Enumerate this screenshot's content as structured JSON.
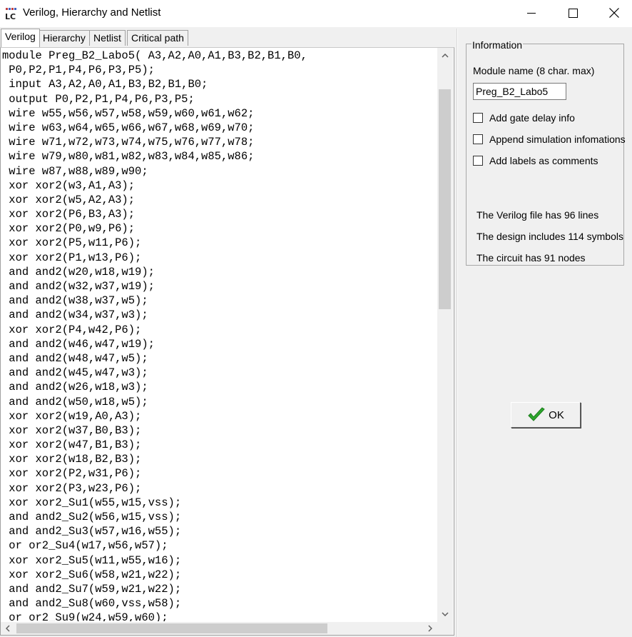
{
  "window": {
    "title": "Verilog, Hierarchy and Netlist",
    "app_icon": "verilog-app-icon",
    "controls": [
      "minimize-icon",
      "maximize-icon",
      "close-icon"
    ]
  },
  "tabs": [
    {
      "label": "Verilog",
      "active": true
    },
    {
      "label": "Hierarchy",
      "active": false
    },
    {
      "label": "Netlist",
      "active": false
    },
    {
      "label": "Critical path",
      "active": false
    }
  ],
  "code_lines": [
    "module Preg_B2_Labo5( A3,A2,A0,A1,B3,B2,B1,B0,",
    " P0,P2,P1,P4,P6,P3,P5);",
    " input A3,A2,A0,A1,B3,B2,B1,B0;",
    " output P0,P2,P1,P4,P6,P3,P5;",
    " wire w55,w56,w57,w58,w59,w60,w61,w62;",
    " wire w63,w64,w65,w66,w67,w68,w69,w70;",
    " wire w71,w72,w73,w74,w75,w76,w77,w78;",
    " wire w79,w80,w81,w82,w83,w84,w85,w86;",
    " wire w87,w88,w89,w90;",
    " xor xor2(w3,A1,A3);",
    " xor xor2(w5,A2,A3);",
    " xor xor2(P6,B3,A3);",
    " xor xor2(P0,w9,P6);",
    " xor xor2(P5,w11,P6);",
    " xor xor2(P1,w13,P6);",
    " and and2(w20,w18,w19);",
    " and and2(w32,w37,w19);",
    " and and2(w38,w37,w5);",
    " and and2(w34,w37,w3);",
    " xor xor2(P4,w42,P6);",
    " and and2(w46,w47,w19);",
    " and and2(w48,w47,w5);",
    " and and2(w45,w47,w3);",
    " and and2(w26,w18,w3);",
    " and and2(w50,w18,w5);",
    " xor xor2(w19,A0,A3);",
    " xor xor2(w37,B0,B3);",
    " xor xor2(w47,B1,B3);",
    " xor xor2(w18,B2,B3);",
    " xor xor2(P2,w31,P6);",
    " xor xor2(P3,w23,P6);",
    " xor xor2_Su1(w55,w15,vss);",
    " and and2_Su2(w56,w15,vss);",
    " and and2_Su3(w57,w16,w55);",
    " or or2_Su4(w17,w56,w57);",
    " xor xor2_Su5(w11,w55,w16);",
    " xor xor2_Su6(w58,w21,w22);",
    " and and2_Su7(w59,w21,w22);",
    " and and2_Su8(w60,vss,w58);",
    " or or2_Su9(w24,w59,w60);"
  ],
  "info": {
    "legend": "Information",
    "module_name_label": "Module name  (8 char. max)",
    "module_name_value": "Preg_B2_Labo5",
    "checkboxes": [
      {
        "label": "Add gate delay info",
        "checked": false
      },
      {
        "label": "Append simulation infomations",
        "checked": false
      },
      {
        "label": "Add labels as comments",
        "checked": false
      }
    ],
    "stats": [
      "The Verilog file has 96 lines",
      "The design includes 114 symbols",
      "The circuit has 91 nodes"
    ]
  },
  "ok_button": {
    "label": "OK",
    "icon": "green-check-icon",
    "icon_color": "#2ea82e"
  },
  "scrollbars": {
    "vertical_position": 0.07,
    "horizontal_position": 0.0
  }
}
